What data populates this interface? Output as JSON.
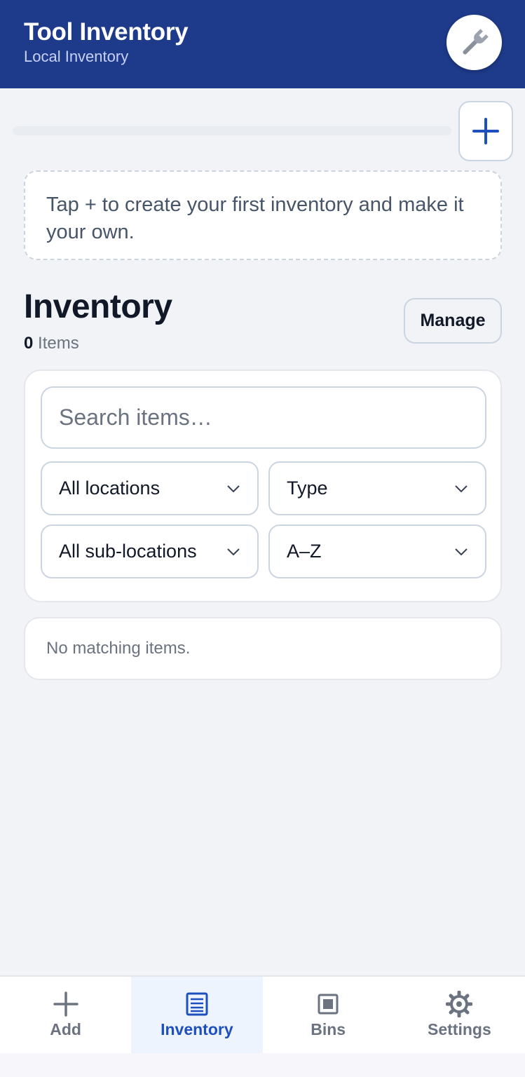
{
  "header": {
    "title": "Tool Inventory",
    "subtitle": "Local Inventory",
    "avatar_icon": "wrench-icon"
  },
  "add_inventory": {
    "icon": "plus-icon"
  },
  "hint": {
    "text": "Tap + to create your first inventory and make it your own."
  },
  "inventory": {
    "title": "Inventory",
    "count": "0",
    "count_label": "Items",
    "manage_label": "Manage"
  },
  "filters": {
    "search_placeholder": "Search items…",
    "location": "All locations",
    "type": "Type",
    "sub_location": "All sub-locations",
    "sort": "A–Z"
  },
  "empty_state": "No matching items.",
  "nav": {
    "items": [
      {
        "label": "Add",
        "icon": "plus-icon",
        "active": false
      },
      {
        "label": "Inventory",
        "icon": "list-icon",
        "active": true
      },
      {
        "label": "Bins",
        "icon": "bin-icon",
        "active": false
      },
      {
        "label": "Settings",
        "icon": "gear-icon",
        "active": false
      }
    ]
  },
  "colors": {
    "header_bg": "#1e3a8a",
    "accent": "#1e4fbf",
    "page_bg": "#f1f3f6"
  }
}
